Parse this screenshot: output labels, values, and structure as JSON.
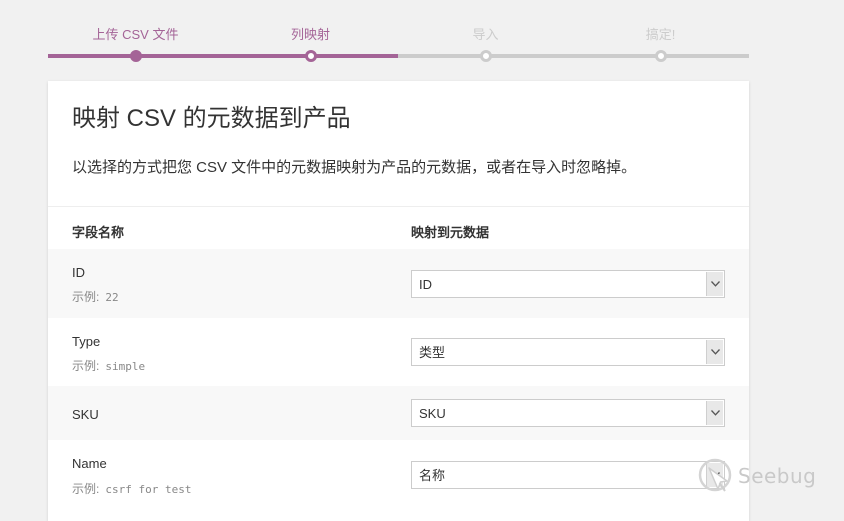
{
  "stepper": {
    "steps": [
      {
        "label": "上传 CSV 文件",
        "state": "done"
      },
      {
        "label": "列映射",
        "state": "active"
      },
      {
        "label": "导入",
        "state": "todo"
      },
      {
        "label": "搞定!",
        "state": "todo"
      }
    ],
    "accent_color": "#a46497",
    "inactive_color": "#cccccc"
  },
  "card": {
    "title": "映射 CSV 的元数据到产品",
    "description": "以选择的方式把您 CSV 文件中的元数据映射为产品的元数据，或者在导入时忽略掉。",
    "columns": {
      "field_name": "字段名称",
      "map_to": "映射到元数据"
    },
    "rows": [
      {
        "field": "ID",
        "example_label": "示例:",
        "example_value": "22",
        "mapped": "ID"
      },
      {
        "field": "Type",
        "example_label": "示例:",
        "example_value": "simple",
        "mapped": "类型"
      },
      {
        "field": "SKU",
        "example_label": "",
        "example_value": "",
        "mapped": "SKU"
      },
      {
        "field": "Name",
        "example_label": "示例:",
        "example_value": "csrf for test",
        "mapped": "名称"
      }
    ]
  },
  "watermark": {
    "text": "Seebug",
    "icon": "seebug-logo-icon"
  }
}
